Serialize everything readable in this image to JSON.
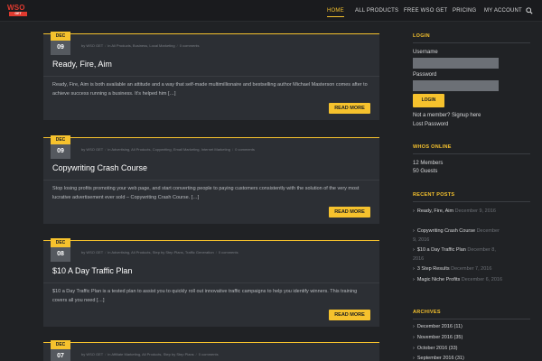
{
  "header": {
    "logo_top": "WSO",
    "logo_bottom": "GET",
    "nav": [
      "HOME",
      "ALL PRODUCTS",
      "FREE WSO GET",
      "PRICING",
      "MY ACCOUNT"
    ],
    "active_nav": "HOME",
    "accent": "#f6c22d"
  },
  "posts": [
    {
      "month": "DEC",
      "day": "09",
      "author": "by WSO GET",
      "categories": "in Ali Products, Business, Local Marketing",
      "comments": "0 comments",
      "title": "Ready, Fire, Aim",
      "excerpt": "Ready, Fire, Aim is both available an attitude and a way that self-made multimillionaire and bestselling author Michael Masterson comes after to achieve success running a business. It’s helped him […]",
      "more": "READ MORE"
    },
    {
      "month": "DEC",
      "day": "09",
      "author": "by WSO GET",
      "categories": "in Advertising, Ali Products, Copywriting, Email Marketing, Internet Marketing",
      "comments": "0 comments",
      "title": "Copywriting Crash Course",
      "excerpt": "Stop losing profits promoting your web page, and start converting people to paying customers consistently with the solution of the very most lucrative advertisement ever sold – Copywriting Crash Course. […]",
      "more": "READ MORE"
    },
    {
      "month": "DEC",
      "day": "08",
      "author": "by WSO GET",
      "categories": "in Advertising, Ali Products, Step by Step Plans, Traffic Generation",
      "comments": "0 comments",
      "title": "$10 A Day Traffic Plan",
      "excerpt": "$10 a Day Traffic Plan is a tested plan to assist you to quickly roll out innovative traffic campaigns to help you identify winners. This training covers all you need […]",
      "more": "READ MORE"
    },
    {
      "month": "DEC",
      "day": "07",
      "author": "by WSO GET",
      "categories": "in Affiliate Marketing, Ali Products, Step by Step Plans",
      "comments": "0 comments"
    }
  ],
  "sidebar": {
    "login": {
      "title": "LOGIN",
      "username_label": "Username",
      "password_label": "Password",
      "button": "LOGIN",
      "signup": "Not a member? Signup here",
      "lost": "Lost Password"
    },
    "online": {
      "title": "WHOS ONLINE",
      "members": "12 Members",
      "guests": "50 Guests"
    },
    "recent": {
      "title": "RECENT POSTS",
      "items": [
        {
          "title": "Ready, Fire, Aim",
          "date": "December 9, 2016"
        },
        {
          "title": "Copywriting Crash Course",
          "date": "December 9, 2016"
        },
        {
          "title": "$10 a Day Traffic Plan",
          "date": "December 8, 2016"
        },
        {
          "title": "3 Step Results",
          "date": "December 7, 2016"
        },
        {
          "title": "Magic Niche Profits",
          "date": "December 6, 2016"
        }
      ]
    },
    "archives": {
      "title": "ARCHIVES",
      "items": [
        "December 2016 (11)",
        "November 2016 (35)",
        "October 2016 (33)",
        "September 2016 (31)"
      ]
    }
  }
}
